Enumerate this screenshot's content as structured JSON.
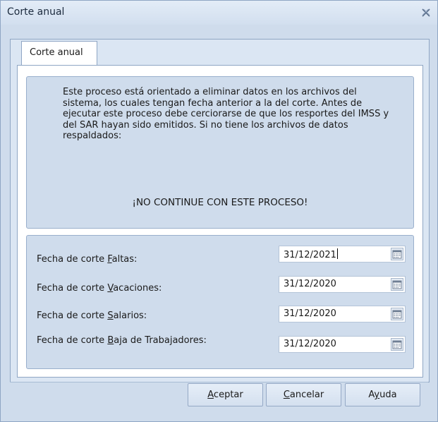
{
  "window": {
    "title": "Corte anual",
    "close_icon": "close-icon"
  },
  "tab": {
    "label": "Corte anual"
  },
  "info": {
    "message": "Este proceso está orientado a eliminar datos en los archivos del sistema, los cuales tengan fecha anterior a la del corte. Antes de ejecutar este proceso debe cerciorarse de que los resportes del IMSS y del SAR hayan sido emitidos. Si no tiene los archivos de datos respaldados:",
    "warning": "¡NO CONTINUE CON ESTE PROCESO!"
  },
  "dates": [
    {
      "label_prefix": "Fecha de corte ",
      "label_mnemonic": "F",
      "label_rest": "altas:",
      "value": "31/12/2021",
      "calendar_icon": "calendar-icon"
    },
    {
      "label_prefix": "Fecha de corte ",
      "label_mnemonic": "V",
      "label_rest": "acaciones:",
      "value": "31/12/2020",
      "calendar_icon": "calendar-icon"
    },
    {
      "label_prefix": "Fecha de corte ",
      "label_mnemonic": "S",
      "label_rest": "alarios:",
      "value": "31/12/2020",
      "calendar_icon": "calendar-icon"
    },
    {
      "label_prefix": "Fecha de corte ",
      "label_mnemonic": "B",
      "label_rest": "aja de Trabajadores:",
      "value": "31/12/2020",
      "calendar_icon": "calendar-icon"
    }
  ],
  "buttons": {
    "accept": {
      "mnemonic": "A",
      "rest": "ceptar"
    },
    "cancel": {
      "mnemonic": "C",
      "rest": "ancelar"
    },
    "help": {
      "pre": "A",
      "mnemonic": "y",
      "rest": "uda"
    }
  },
  "colors": {
    "panel": "#cfdcec",
    "border": "#8fa6c4"
  }
}
